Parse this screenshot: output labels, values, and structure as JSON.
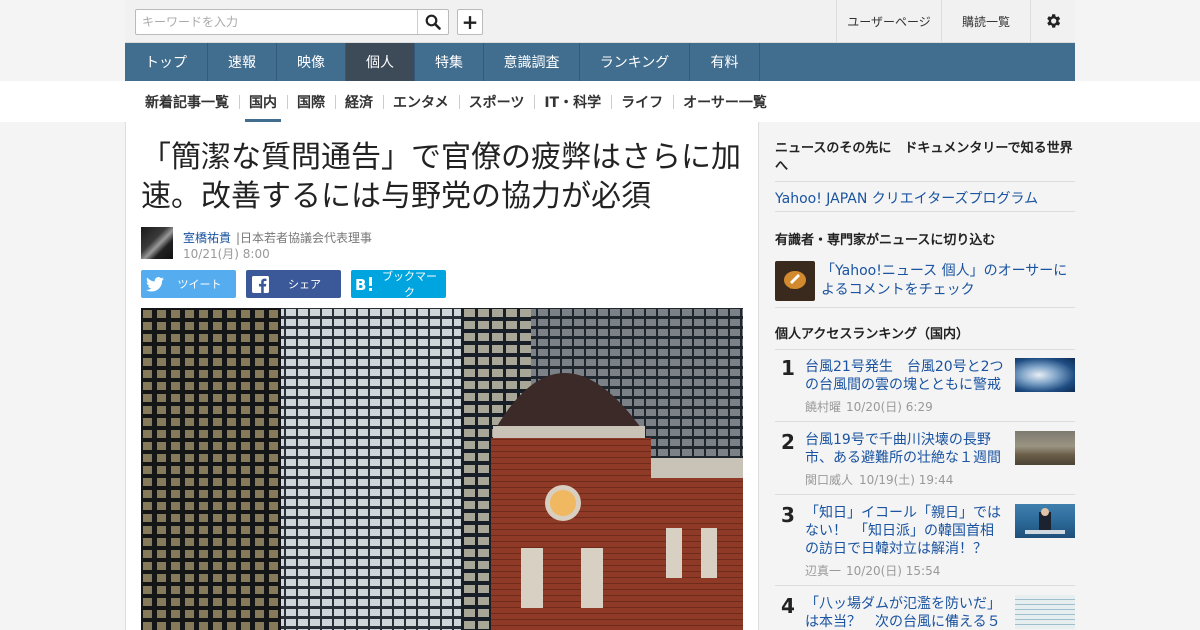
{
  "search": {
    "placeholder": "キーワードを入力"
  },
  "header_links": {
    "user_page": "ユーザーページ",
    "subscriptions": "購読一覧"
  },
  "main_nav": [
    {
      "label": "トップ"
    },
    {
      "label": "速報"
    },
    {
      "label": "映像"
    },
    {
      "label": "個人"
    },
    {
      "label": "特集"
    },
    {
      "label": "意識調査"
    },
    {
      "label": "ランキング"
    },
    {
      "label": "有料"
    }
  ],
  "sub_nav": [
    {
      "label": "新着記事一覧"
    },
    {
      "label": "国内"
    },
    {
      "label": "国際"
    },
    {
      "label": "経済"
    },
    {
      "label": "エンタメ"
    },
    {
      "label": "スポーツ"
    },
    {
      "label": "IT・科学"
    },
    {
      "label": "ライフ"
    },
    {
      "label": "オーサー一覧"
    }
  ],
  "article": {
    "headline": "「簡潔な質問通告」で官僚の疲弊はさらに加速。改善するには与野党の協力が必須",
    "author": "室橋祐貴",
    "author_role": "|日本若者協議会代表理事",
    "date": "10/21(月) 8:00",
    "share": {
      "tweet": "ツイート",
      "facebook": "シェア",
      "bookmark": "ブックマーク"
    }
  },
  "sidebar": {
    "promo_heading": "ニュースのその先に　ドキュメンタリーで知る世界へ",
    "promo_link": "Yahoo! JAPAN クリエイターズプログラム",
    "expert_heading": "有識者・専門家がニュースに切り込む",
    "expert_link": "「Yahoo!ニュース 個人」のオーサーによるコメントをチェック",
    "ranking_heading": "個人アクセスランキング（国内）",
    "ranking": [
      {
        "rank": "1",
        "title": "台風21号発生　台風20号と2つの台風間の雲の塊とともに警戒",
        "author": "饒村曜",
        "date": "10/20(日) 6:29"
      },
      {
        "rank": "2",
        "title": "台風19号で千曲川決壊の長野市、ある避難所の壮絶な１週間",
        "author": "関口威人",
        "date": "10/19(土) 19:44"
      },
      {
        "rank": "3",
        "title": "「知日」イコール「親日」ではない！　「知日派」の韓国首相の訪日で日韓対立は解消！？",
        "author": "辺真一",
        "date": "10/20(日) 15:54"
      },
      {
        "rank": "4",
        "title": "「八ッ場ダムが氾濫を防いだ」は本当？　次の台風に備える５",
        "author": "",
        "date": ""
      }
    ]
  },
  "colors": {
    "nav_bg": "#416d8f",
    "nav_active": "#3d4a57",
    "link": "#1a53a0",
    "twitter": "#55acee",
    "facebook": "#3b5998",
    "hatena": "#00a4de"
  }
}
